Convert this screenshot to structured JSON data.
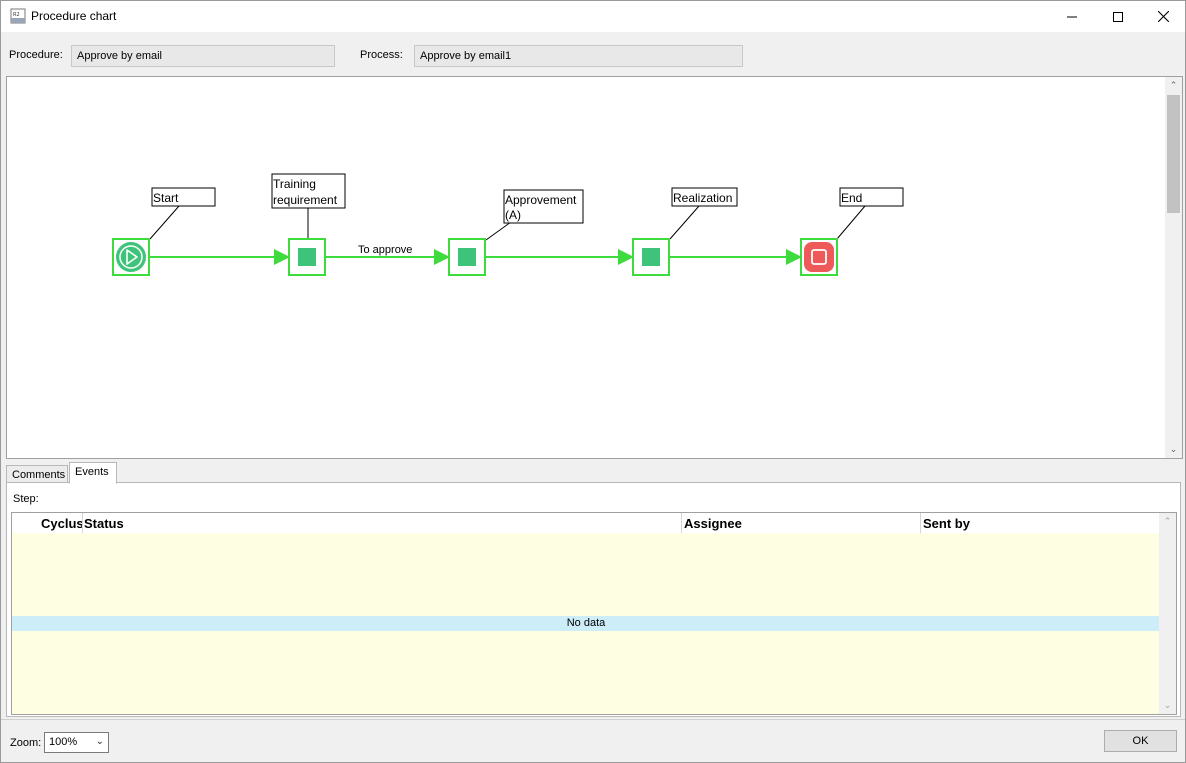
{
  "window": {
    "title": "Procedure chart",
    "minimize_icon": "minimize-icon",
    "maximize_icon": "maximize-icon",
    "close_icon": "close-icon"
  },
  "fields": {
    "procedure_label": "Procedure:",
    "procedure_value": "Approve by email",
    "process_label": "Process:",
    "process_value": "Approve by email1"
  },
  "diagram": {
    "colors": {
      "flow": "#3ddb3d",
      "node_fill": "#3ec47a",
      "end_fill": "#ee5a5a"
    },
    "nodes": [
      {
        "id": "start",
        "label": "Start"
      },
      {
        "id": "training",
        "label_line1": "Training",
        "label_line2": "requirement"
      },
      {
        "id": "approvement",
        "label_line1": "Approvement",
        "label_line2": "(A)"
      },
      {
        "id": "realization",
        "label": "Realization"
      },
      {
        "id": "end",
        "label": "End"
      }
    ],
    "transitions": [
      {
        "label": "To approve"
      }
    ]
  },
  "tabs": [
    {
      "label": "Comments"
    },
    {
      "label": "Events"
    }
  ],
  "events": {
    "step_label": "Step:",
    "columns": [
      "Cyclus",
      "Status",
      "Assignee",
      "Sent by"
    ],
    "empty_text": "No data",
    "row_color": "#fefee3",
    "empty_row_color": "#cdeef9"
  },
  "footer": {
    "zoom_label": "Zoom:",
    "zoom_value": "100%",
    "ok_label": "OK"
  }
}
